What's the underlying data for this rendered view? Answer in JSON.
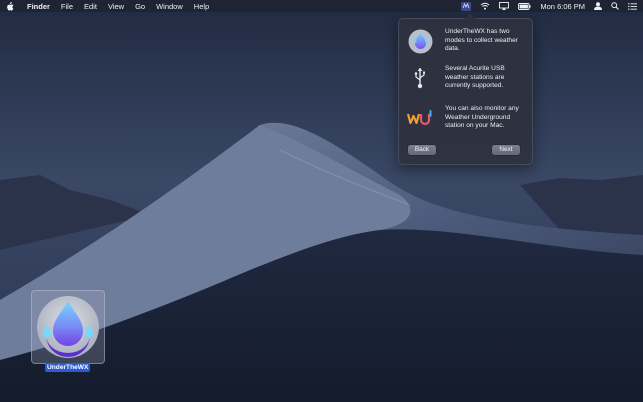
{
  "menubar": {
    "app_name": "Finder",
    "menus": [
      "File",
      "Edit",
      "View",
      "Go",
      "Window",
      "Help"
    ],
    "clock": "Mon 6:06 PM",
    "status_icons": [
      "underthewx-menu-icon",
      "wifi-icon",
      "airplay-icon",
      "battery-icon",
      "user-icon",
      "spotlight-icon",
      "notification-center-icon"
    ]
  },
  "popover": {
    "rows": [
      {
        "icon": "underthewx-logo-icon",
        "text": "UnderTheWX has two modes to collect weather data."
      },
      {
        "icon": "usb-icon",
        "text": "Several Acurite USB weather stations are currently supported."
      },
      {
        "icon": "weather-underground-icon",
        "text": "You can also monitor any Weather Underground station on your Mac."
      }
    ],
    "back_label": "Back",
    "next_label": "Next"
  },
  "desktop": {
    "icon_label": "UnderTheWX",
    "icon": "underthewx-app-icon"
  },
  "colors": {
    "accent": "#2b5cd6",
    "popover_bg": "#2e3240",
    "menubar_bg": "#1e2230"
  }
}
